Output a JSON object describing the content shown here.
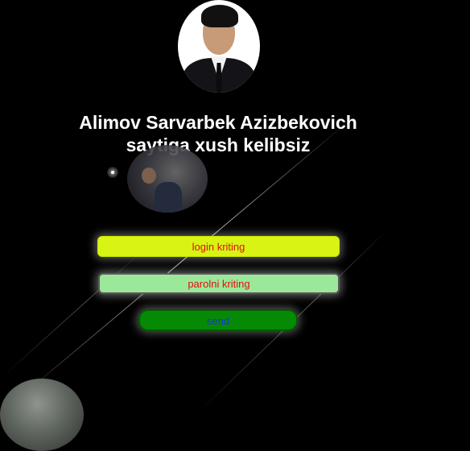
{
  "header": {
    "title_line1": "Alimov Sarvarbek Azizbekovich",
    "title_line2": "saytiga xush kelibsiz"
  },
  "form": {
    "login_placeholder": "login kriting",
    "password_placeholder": "parolni kriting",
    "send_label": "send"
  },
  "colors": {
    "background": "#000000",
    "login_field": "#d8f415",
    "password_field": "#9ce89a",
    "send_button": "#068a06",
    "placeholder_text": "#e01010",
    "send_text": "#1b33d8"
  }
}
